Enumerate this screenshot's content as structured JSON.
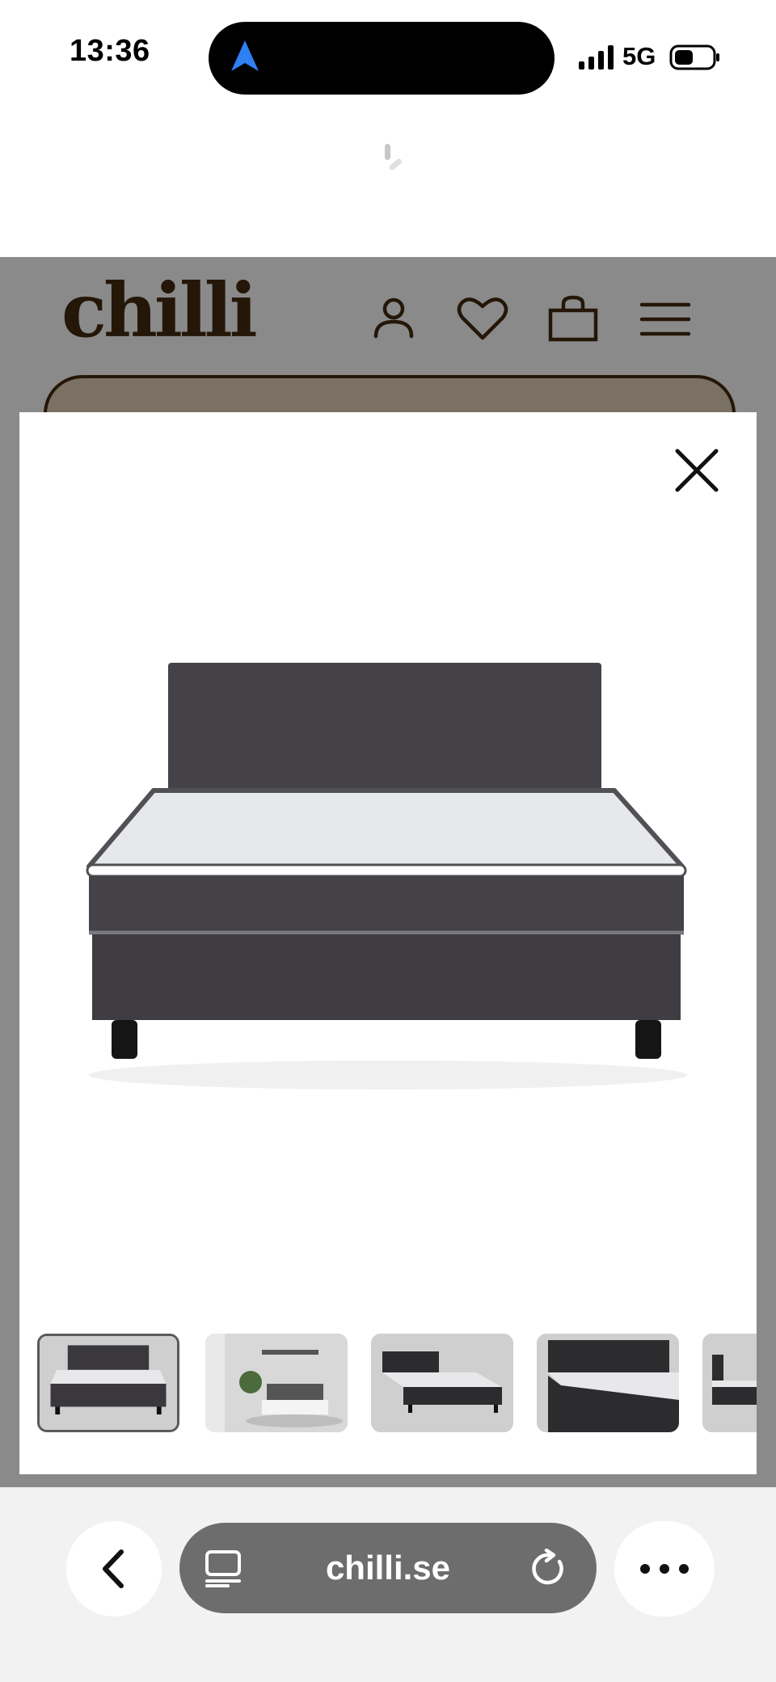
{
  "status_bar": {
    "time": "13:36",
    "network": "5G",
    "icons": [
      "location-arrow-icon",
      "signal-icon",
      "battery-icon"
    ]
  },
  "site": {
    "logo": "chilli",
    "header_icons": [
      "account-icon",
      "wishlist-heart-icon",
      "cart-bag-icon",
      "menu-icon"
    ]
  },
  "gallery": {
    "main_image": "bed-with-dark-gray-headboard-and-white-mattress",
    "thumbnails": [
      {
        "name": "thumb-bed-front",
        "selected": true
      },
      {
        "name": "thumb-bedroom-scene",
        "selected": false
      },
      {
        "name": "thumb-bed-angle",
        "selected": false
      },
      {
        "name": "thumb-bed-closeup",
        "selected": false
      },
      {
        "name": "thumb-bed-side",
        "selected": false
      }
    ],
    "close_icon": "close-icon"
  },
  "browser": {
    "url": "chilli.se",
    "icons": [
      "back-chevron-icon",
      "reader-icon",
      "reload-icon",
      "more-dots-icon"
    ]
  },
  "colors": {
    "brand": "#241708",
    "overlay": "#8a8a8a",
    "location_blue": "#2f7ff5",
    "headboard": "#444147",
    "mattress": "#e6e8ec"
  }
}
